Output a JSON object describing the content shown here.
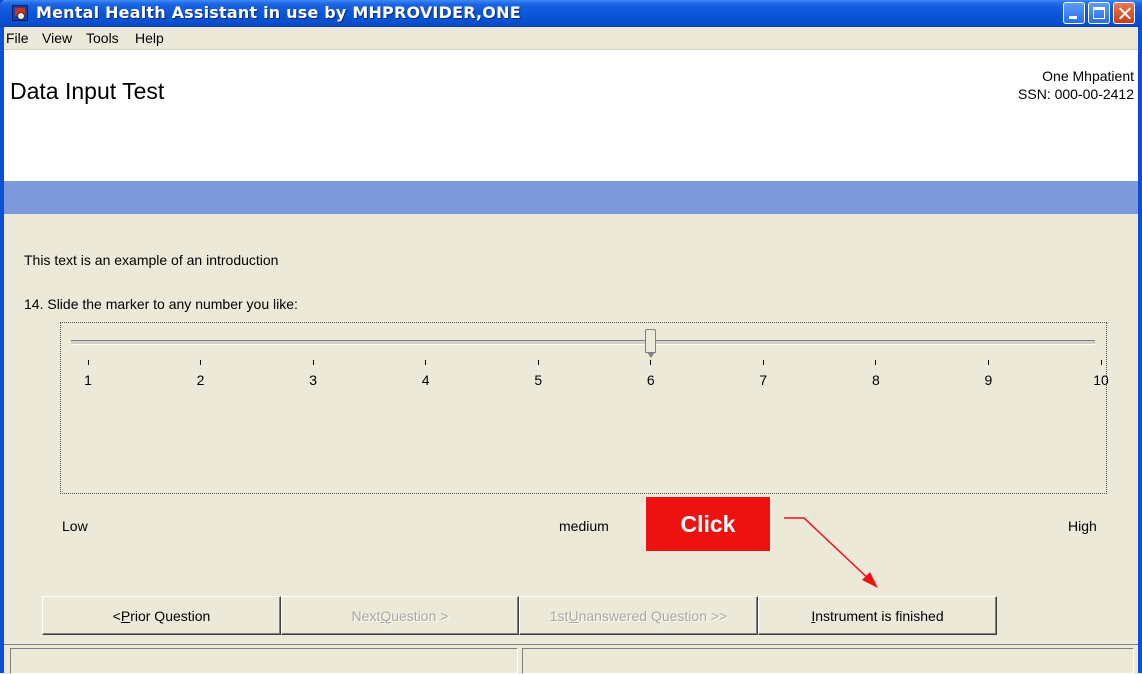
{
  "window": {
    "title": "Mental Health Assistant in use by MHPROVIDER,ONE"
  },
  "menu": [
    "File",
    "View",
    "Tools",
    "Help"
  ],
  "header": {
    "page_title": "Data Input Test",
    "patient_name": "One Mhpatient",
    "ssn": "SSN: 000-00-2412"
  },
  "content": {
    "intro": "This text is an example of an introduction",
    "question": "14. Slide the marker to any number you like:"
  },
  "slider": {
    "min": 1,
    "max": 10,
    "value": 6,
    "tick_labels": [
      "1",
      "2",
      "3",
      "4",
      "5",
      "6",
      "7",
      "8",
      "9",
      "10"
    ],
    "low_label": "Low",
    "mid_label": "medium",
    "high_label": "High"
  },
  "annotation": {
    "callout": "Click",
    "color": "#ee1111"
  },
  "buttons": {
    "prior": {
      "prefix": "< ",
      "key": "P",
      "rest": "rior Question"
    },
    "next": {
      "prefix": "Next ",
      "key": "Q",
      "rest": "uestion >"
    },
    "first_unanswered": {
      "prefix": "1st ",
      "key": "U",
      "rest": "nanswered Question >>"
    },
    "finished": {
      "prefix": "",
      "key": "I",
      "rest": "nstrument is finished"
    }
  },
  "colors": {
    "titlebar": "#0b56d8",
    "band": "#7d99d9",
    "background": "#ece9d8"
  }
}
